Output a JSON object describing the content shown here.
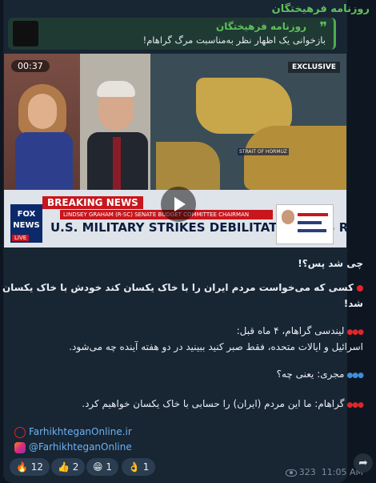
{
  "channel": {
    "name": "روزنامه فرهیختگان"
  },
  "reply": {
    "name": "روزنامه فرهیختگان",
    "text": "بازخوانی یک اظهار نظر به‌مناسبت مرگ گراهام!"
  },
  "video": {
    "duration": "00:37",
    "badge": "EXCLUSIVE",
    "breaking": "BREAKING NEWS",
    "nameplate": "LINDSEY GRAHAM (R-SC)  SENATE BUDGET COMMITTEE CHAIRMAN",
    "headline": "U.S. MILITARY STRIKES DEBILITATE IRAN'S REGIME",
    "network": "FOX NEWS",
    "live": "LIVE",
    "map_label": "STRAIT OF HORMUZ"
  },
  "message": {
    "line1": "چی شد پس؟!",
    "line2": "کسی که می‌خواست مردم ایران را با خاک یکسان کند خودش با خاک یکسان",
    "line3": "شد!",
    "line4": "لیندسی گراهام، ۴ ماه قبل:",
    "line5": "اسرائیل و ایالات متحده، فقط صبر کنید ببینید در دو هفته آینده چه می‌شود.",
    "line6": "مجری: یعنی چه؟",
    "line7": "گراهام: ما این مردم (ایران) را حسابی با خاک یکسان خواهیم کرد."
  },
  "links": {
    "website": "FarhikhteganOnline.ir",
    "instagram": "@FarhikhteganOnline"
  },
  "reactions": [
    {
      "emoji": "🔥",
      "count": "12"
    },
    {
      "emoji": "👍",
      "count": "2"
    },
    {
      "emoji": "😁",
      "count": "1"
    },
    {
      "emoji": "👌",
      "count": "1"
    }
  ],
  "meta": {
    "views": "323",
    "time": "11:05 AM"
  },
  "colors": {
    "accent": "#5fc05b",
    "link": "#6ab3f3",
    "bubble": "#182533",
    "background": "#0e1621"
  },
  "icons": {
    "share": "share-icon",
    "views": "eye-icon",
    "website": "globe-icon",
    "instagram": "instagram-icon"
  }
}
